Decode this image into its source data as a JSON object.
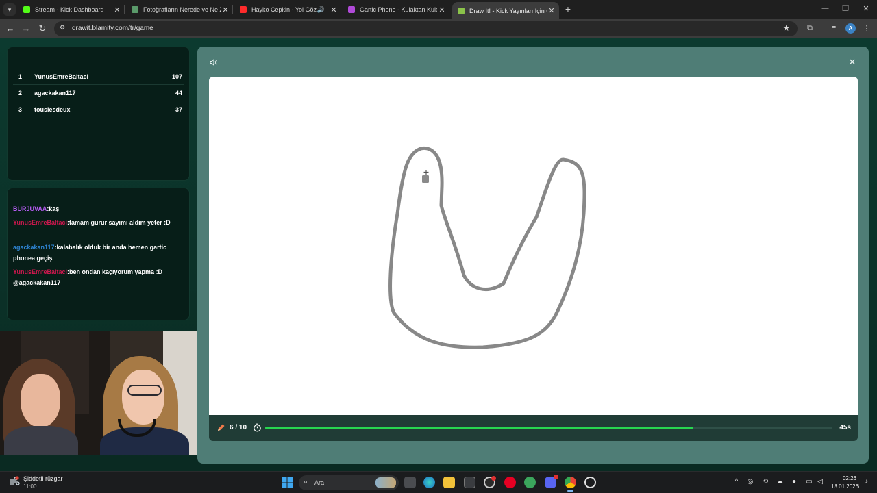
{
  "browser": {
    "tabs": [
      {
        "title": "Stream - Kick Dashboard",
        "favicon": "kick-icon",
        "color": "#53fc18"
      },
      {
        "title": "Fotoğrafların Nerede ve Ne Zaman",
        "favicon": "photos-icon",
        "color": "#5a9a6a"
      },
      {
        "title": "Hayko Cepkin - Yol Gözüm",
        "favicon": "youtube-icon",
        "color": "#ff2b2b"
      },
      {
        "title": "Gartic Phone - Kulaktan Kulağa",
        "favicon": "gartic-icon",
        "color": "#b04ad8"
      },
      {
        "title": "Draw It! - Kick Yayınları İçin Çizim",
        "favicon": "drawit-icon",
        "color": "#8bc34a"
      }
    ],
    "url": "drawit.blamity.com/tr/game",
    "profile_initial": "A"
  },
  "leaderboard": [
    {
      "rank": "1",
      "name": "YunusEmreBaltaci",
      "score": "107"
    },
    {
      "rank": "2",
      "name": "agackakan117",
      "score": "44"
    },
    {
      "rank": "3",
      "name": "touslesdeux",
      "score": "37"
    }
  ],
  "chat": [
    {
      "user": "BURJUVAA",
      "color": "#b65cf2",
      "text": ":kaş"
    },
    {
      "user": "YunusEmreBaltaci",
      "color": "#d0184f",
      "text": ":tamam gurur sayımı aldım yeter :D"
    },
    {
      "user": "agackakan117",
      "color": "#2f86d6",
      "text": ":kalabalık olduk bir anda hemen gartic phonea geçiş"
    },
    {
      "user": "YunusEmreBaltaci",
      "color": "#d0184f",
      "text": ":ben ondan kaçıyorum yapma :D @agackakan117"
    }
  ],
  "game": {
    "round": "6 / 10",
    "time_left": "45s",
    "progress_fraction": 0.755,
    "progress_color": "#27d650"
  },
  "taskbar": {
    "weather_title": "Şiddetli rüzgar",
    "weather_sub": "11:00",
    "search_placeholder": "Ara",
    "clock_time": "02:26",
    "clock_date": "18.01.2026"
  }
}
